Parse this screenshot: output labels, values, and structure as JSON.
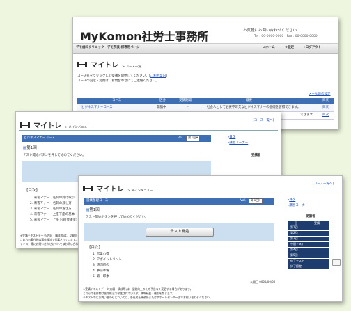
{
  "back": {
    "logo": "MyKomon",
    "office": "社労士事務所",
    "contact_label": "お気軽にお問い合わせください",
    "contact_tel_fax": "Tel : 00-0000-0000　Fax : 00-0000-0000",
    "nav_left": "デモ歯科クリニック　デモ院長 様専用ページ",
    "nav_home": "ホーム",
    "nav_settings": "設定",
    "nav_logout": "ログアウト",
    "app_title": "マイトレ",
    "breadcrumb": "> コース一覧",
    "intro_line1": "コース名をクリックして受講を開始してください。",
    "intro_link": "ご利用案内",
    "intro_line2": "コースの設定・変更は、お問合わせにてご連絡ください。",
    "mail_link": "メール送信設定",
    "table_headers": [
      "コース",
      "区分",
      "受講期間",
      "概要",
      "目次"
    ],
    "row1": [
      "ビジネスマナーコース",
      "開講中",
      "-",
      "社会人として必要不可欠なビジネスマナーの基礎を習得できます。",
      "目次"
    ],
    "row2_tail": "できます。",
    "row2_toc": "目次"
  },
  "mid": {
    "app_title": "マイトレ",
    "breadcrumb": "> メインメニュー",
    "top_link": "[コース一覧へ]",
    "course_title": "ビジネスマナーコース",
    "vol_label": "Vol.",
    "vol_value": "第1回",
    "lesson_heading": "第1回",
    "lesson_instruction": "テスト開始ボタンを押して始めてください。",
    "side_links": [
      "目次",
      "講習コーナー"
    ],
    "side_header": "受講者",
    "toc_title": "【目次】",
    "toc_items": [
      "1. 来客マナー　名刺の受け取り",
      "2. 来客マナー　名刺の渡し方",
      "3. 来客マナー　名刺の置き方",
      "4. 来客マナー　上座下座の基本",
      "5. 来客マナー　上座下座(会議室)"
    ],
    "notes": [
      "※受講テキストデータ(内容・構成等)は、品質向上のため予告なく変更する場合があります。",
      "これらの著作物は著作権法で保護されています。",
      "テキスト等にお問い合わせについてはお問い合わせください。"
    ]
  },
  "front": {
    "app_title": "マイトレ",
    "breadcrumb": "> メインメニュー",
    "top_link": "[コース一覧へ]",
    "course_title": "営業基礎コース",
    "vol_label": "Vol.",
    "vol_value": "第1回",
    "lesson_heading": "第1回",
    "lesson_instruction": "テスト開始ボタンを押して始めてください。",
    "test_button": "テスト開始",
    "side_links": [
      "目次",
      "講習コーナー"
    ],
    "side_header": "受講者",
    "side_cols": [
      "回",
      "受講"
    ],
    "side_rows": [
      "第1回",
      "第2回",
      "第3回",
      "中間テスト",
      "第4回",
      "第5回",
      "修了テスト",
      "修了認定"
    ],
    "toc_title": "【目次】",
    "toc_items": [
      "1. 営業心得",
      "2. アポイントメント",
      "3. 訪問前の",
      "4. 事前準備",
      "5. 第一印象"
    ],
    "footer_right": "公開日 0000/00/00",
    "notes": [
      "※受講テキストデータ(内容・構成等)は、品質向上のため予告なく変更する場合があります。",
      "これらの著作物は著作権法で保護されています。無断転載・複製を禁じます。",
      "テキスト等にお問い合わせについては、各社労士事務所またはサポートセンターまでお問い合わせください。"
    ]
  },
  "colors": {
    "background": "#eef6df",
    "accent_blue": "#3e6fb3",
    "navy": "#1f3c6e",
    "link": "#1d4fb3",
    "content_panel": "#cbdff0"
  }
}
